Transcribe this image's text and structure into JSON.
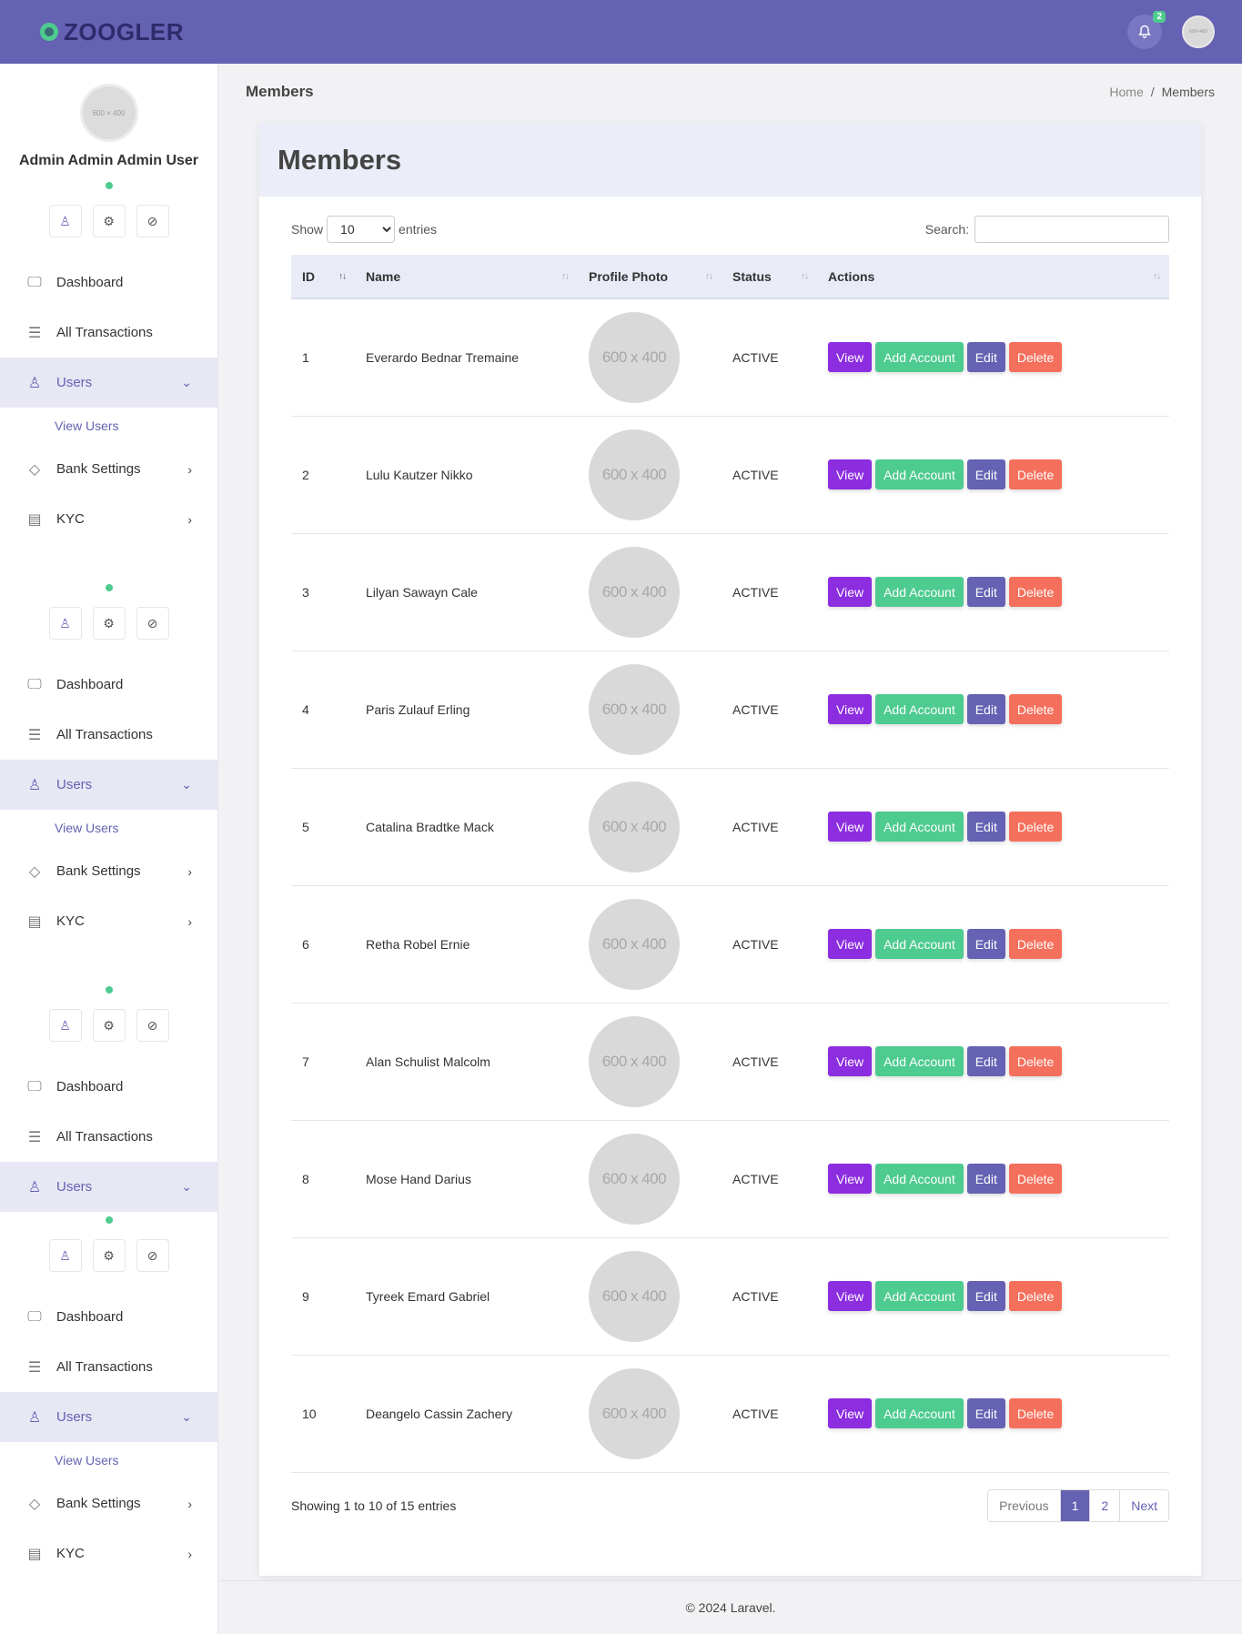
{
  "brand": {
    "name": "ZOOGLER"
  },
  "topbar": {
    "notification_count": "2",
    "avatar_text": "600×400"
  },
  "sidebar": {
    "avatar_text": "600 × 400",
    "user_name": "Admin Admin Admin User",
    "menu": {
      "dashboard": "Dashboard",
      "transactions": "All Transactions",
      "users": "Users",
      "view_users": "View Users",
      "bank_settings": "Bank Settings",
      "kyc": "KYC"
    }
  },
  "page": {
    "header_title": "Members",
    "breadcrumb": {
      "home": "Home",
      "separator": "/",
      "current": "Members"
    },
    "card_title": "Members"
  },
  "table": {
    "show_label": "Show",
    "entries_label": "entries",
    "page_length": "10",
    "search_label": "Search:",
    "columns": {
      "id": "ID",
      "name": "Name",
      "photo": "Profile Photo",
      "status": "Status",
      "actions": "Actions"
    },
    "photo_placeholder": "600 x 400",
    "actions": {
      "view": "View",
      "add_account": "Add Account",
      "edit": "Edit",
      "delete": "Delete"
    },
    "rows": [
      {
        "id": "1",
        "name": "Everardo Bednar Tremaine",
        "status": "ACTIVE"
      },
      {
        "id": "2",
        "name": "Lulu Kautzer Nikko",
        "status": "ACTIVE"
      },
      {
        "id": "3",
        "name": "Lilyan Sawayn Cale",
        "status": "ACTIVE"
      },
      {
        "id": "4",
        "name": "Paris Zulauf Erling",
        "status": "ACTIVE"
      },
      {
        "id": "5",
        "name": "Catalina Bradtke Mack",
        "status": "ACTIVE"
      },
      {
        "id": "6",
        "name": "Retha Robel Ernie",
        "status": "ACTIVE"
      },
      {
        "id": "7",
        "name": "Alan Schulist Malcolm",
        "status": "ACTIVE"
      },
      {
        "id": "8",
        "name": "Mose Hand Darius",
        "status": "ACTIVE"
      },
      {
        "id": "9",
        "name": "Tyreek Emard Gabriel",
        "status": "ACTIVE"
      },
      {
        "id": "10",
        "name": "Deangelo Cassin Zachery",
        "status": "ACTIVE"
      }
    ],
    "info": "Showing 1 to 10 of 15 entries",
    "pagination": {
      "previous": "Previous",
      "page1": "1",
      "page2": "2",
      "next": "Next"
    }
  },
  "footer": {
    "text": "© 2024 Laravel."
  }
}
